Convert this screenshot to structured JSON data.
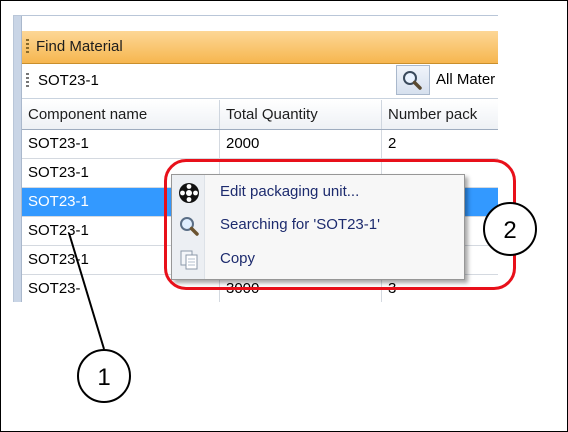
{
  "window": {
    "title": "Find Material"
  },
  "search": {
    "value": "SOT23-1",
    "scope": "All Mater"
  },
  "grid": {
    "columns": [
      "Component name",
      "Total Quantity",
      "Number pack"
    ],
    "rows": [
      [
        "SOT23-1",
        "2000",
        "2"
      ],
      [
        "SOT23-1",
        "",
        ""
      ],
      [
        "SOT23-1",
        "",
        ""
      ],
      [
        "SOT23-1",
        "",
        ""
      ],
      [
        "SOT23-1",
        "",
        ""
      ],
      [
        "SOT23-",
        "3000",
        "3"
      ]
    ],
    "selected_row": 2
  },
  "context_menu": {
    "items": [
      {
        "label": "Edit packaging unit...",
        "icon": "packaging-reel-icon"
      },
      {
        "label": "Searching for 'SOT23-1'",
        "icon": "magnifier-icon"
      },
      {
        "label": "Copy",
        "icon": "copy-icon"
      }
    ]
  },
  "annotations": {
    "callout_1": "1",
    "callout_2": "2",
    "highlight_color": "#e8101a"
  },
  "colors": {
    "titlebar": "#f6b64f",
    "selection": "#3399ff",
    "menu_text": "#1d2b6e"
  }
}
